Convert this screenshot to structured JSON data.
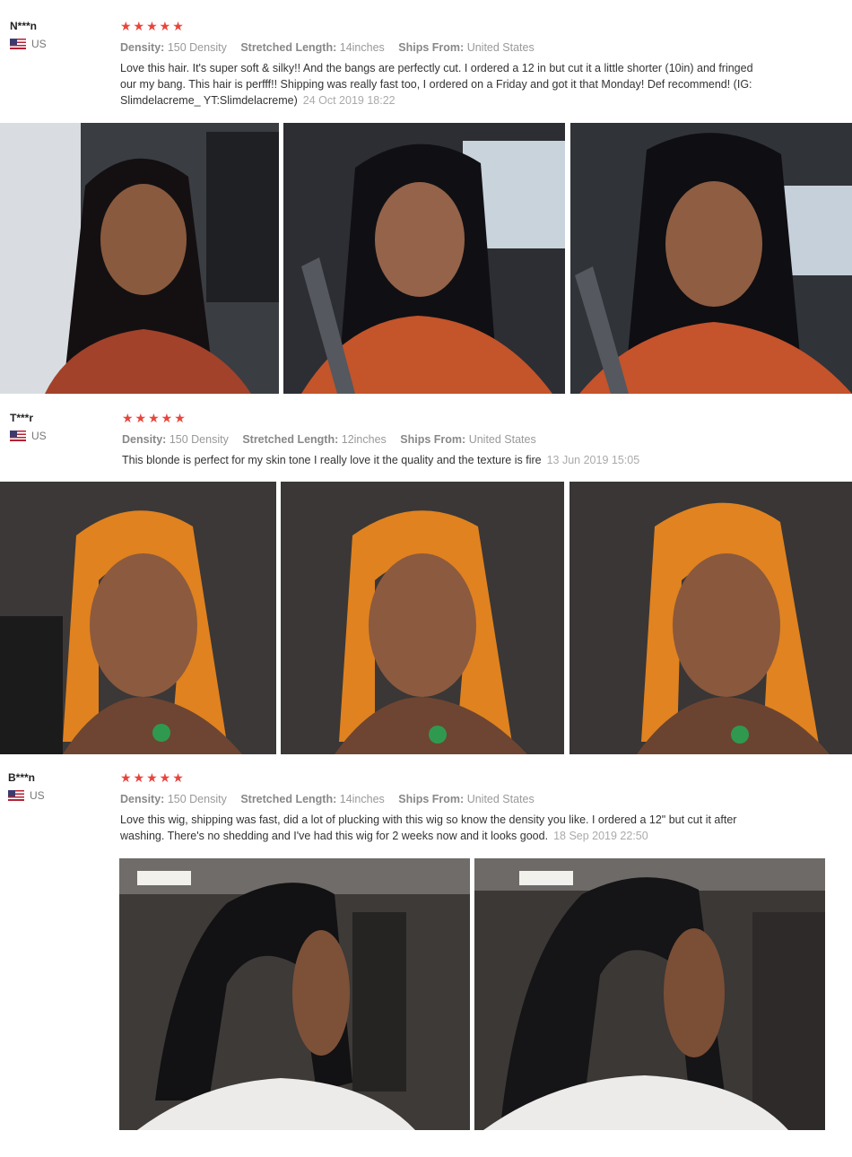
{
  "icons": {
    "rating_star": "star-icon",
    "country_flag": "us-flag-icon"
  },
  "colors": {
    "star": "#e8453c",
    "date": "#aaaaaa",
    "attribute": "#999999"
  },
  "reviews": [
    {
      "name": "N***n",
      "country": "US",
      "stars": "★★★★★",
      "rating": 5,
      "density_label": "Density:",
      "density_value": "150 Density",
      "length_label": "Stretched Length:",
      "length_value": "14inches",
      "ships_label": "Ships From:",
      "ships_value": "United States",
      "text": "Love this hair. It's super soft & silky!! And the bangs are perfectly cut. I ordered a 12 in but cut it a little shorter (10in) and fringed our my bang. This hair is perfff!! Shipping was really fast too, I ordered on a Friday and got it that Monday! Def recommend! (IG: Slimdelacreme_ YT:Slimdelacreme)",
      "date": "24 Oct 2019 18:22"
    },
    {
      "name": "T***r",
      "country": "US",
      "stars": "★★★★★",
      "rating": 5,
      "density_label": "Density:",
      "density_value": "150 Density",
      "length_label": "Stretched Length:",
      "length_value": "12inches",
      "ships_label": "Ships From:",
      "ships_value": "United States",
      "text": "This blonde is perfect for my skin tone I really love it the quality and the texture is fire",
      "date": "13 Jun 2019 15:05"
    },
    {
      "name": "B***n",
      "country": "US",
      "stars": "★★★★★",
      "rating": 5,
      "density_label": "Density:",
      "density_value": "150 Density",
      "length_label": "Stretched Length:",
      "length_value": "14inches",
      "ships_label": "Ships From:",
      "ships_value": "United States",
      "text": "Love this wig, shipping was fast, did a lot of plucking with this wig so know the density you like. I ordered a 12\" but cut it after washing. There's no shedding and I've had this wig for 2 weeks now and it looks good.",
      "date": "18 Sep 2019 22:50"
    }
  ]
}
